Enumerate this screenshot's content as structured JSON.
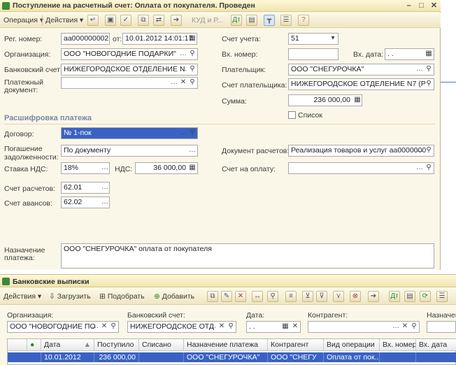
{
  "doc_window": {
    "title": "Поступление на расчетный счет: Оплата от покупателя. Проведен",
    "toolbar": {
      "operation": "Операция",
      "actions": "Действия",
      "kud": "КУД и Р..."
    },
    "fields": {
      "reg_no_label": "Рег. номер:",
      "reg_no": "аа000000002",
      "from_label": "от:",
      "date": "10.01.2012 14:01:17",
      "org_label": "Организация:",
      "org": "ООО \"НОВОГОДНИЕ ПОДАРКИ\"",
      "bank_label": "Банковский счет:",
      "bank": "НИЖЕГОРОДСКОЕ ОТДЕЛЕНИЕ N",
      "pay_doc_label_1": "Платежный",
      "pay_doc_label_2": "документ:",
      "pay_doc": "",
      "account_label": "Счет учета:",
      "account": "51",
      "in_no_label": "Вх. номер:",
      "in_no": "",
      "in_date_label": "Вх. дата:",
      "in_date": ". .",
      "payer_label": "Плательщик:",
      "payer": "ООО \"СНЕГУРОЧКА\"",
      "payer_acc_label": "Счет плательщика:",
      "payer_acc": "НИЖЕГОРОДСКОЕ ОТДЕЛЕНИЕ N7 (Р",
      "sum_label": "Сумма:",
      "sum": "236 000,00",
      "list_label": "Список"
    },
    "section_title": "Расшифровка платежа",
    "details": {
      "contract_label": "Договор:",
      "contract": "№ 1-пок",
      "debt_label_1": "Погашение",
      "debt_label_2": "задолженности:",
      "debt": "По документу",
      "settle_doc_label": "Документ расчетов:",
      "settle_doc": "Реализация товаров и услуг аа0000000",
      "vat_label": "Ставка НДС:",
      "vat": "18%",
      "vat_sum_label": "НДС:",
      "vat_sum": "36 000,00",
      "invoice_label": "Счет на оплату:",
      "invoice": "",
      "settle_acc_label": "Счет расчетов:",
      "settle_acc": "62.01",
      "adv_acc_label": "Счет авансов:",
      "adv_acc": "62.02",
      "purpose_label_1": "Назначение",
      "purpose_label_2": "платежа:",
      "purpose": "ООО \"СНЕГУРОЧКА\" оплата от покупателя"
    }
  },
  "list_window": {
    "title": "Банковские выписки",
    "toolbar": {
      "actions": "Действия",
      "load": "Загрузить",
      "pick": "Подобрать",
      "add": "Добавить"
    },
    "filters": {
      "org_label": "Организация:",
      "org": "ООО \"НОВОГОДНИЕ ПО",
      "bank_label": "Банковский счет:",
      "bank": "НИЖЕГОРОДСКОЕ ОТД",
      "date_label": "Дата:",
      "date": ". .",
      "contractor_label": "Контрагент:",
      "contractor": "",
      "purpose_label": "Назначен"
    },
    "columns": [
      "Дата",
      "Поступило",
      "Списано",
      "Назначение платежа",
      "Контрагент",
      "Вид операции",
      "Вх. номер",
      "Вх. дата"
    ],
    "rows": [
      [
        "10.01.2012",
        "236 000,00",
        "",
        "ООО \"СНЕГУРОЧКА\"",
        "ООО \"СНЕГУ",
        "Оплата от пок...",
        "",
        ""
      ]
    ]
  }
}
